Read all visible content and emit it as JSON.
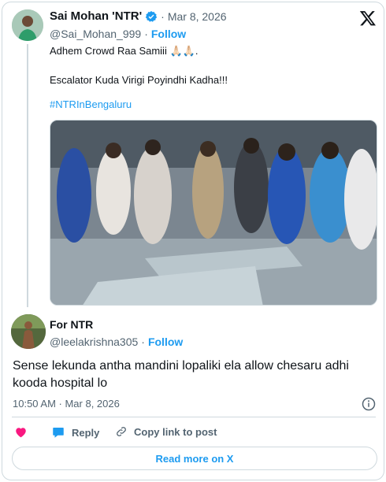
{
  "quoted_tweet": {
    "author_name": "Sai Mohan 'NTR'",
    "handle": "@Sai_Mohan_999",
    "separator": "·",
    "date": "Mar 8, 2026",
    "follow_label": "Follow",
    "text_line_1": "Adhem Crowd Raa Samiii 🙏🏻🙏🏻.",
    "text_line_2": "Escalator Kuda Virigi Poyindhi Kadha!!!",
    "hashtag": "#NTRInBengaluru",
    "media_icon": "video-still-crowd-escalator"
  },
  "reply_tweet": {
    "author_name": "For NTR",
    "handle": "@leelakrishna305",
    "separator": "·",
    "follow_label": "Follow",
    "text": "Sense lekunda antha mandini lopaliki ela allow chesaru adhi kooda hospital lo",
    "timestamp": "10:50 AM · Mar 8, 2026"
  },
  "actions": {
    "like_icon": "heart-icon",
    "reply_label": "Reply",
    "copy_link_label": "Copy link to post"
  },
  "read_more_label": "Read more on X",
  "colors": {
    "accent": "#1d9bf0",
    "like": "#f91880",
    "text": "#0f1419",
    "muted": "#536471",
    "border": "#cfd9de"
  }
}
